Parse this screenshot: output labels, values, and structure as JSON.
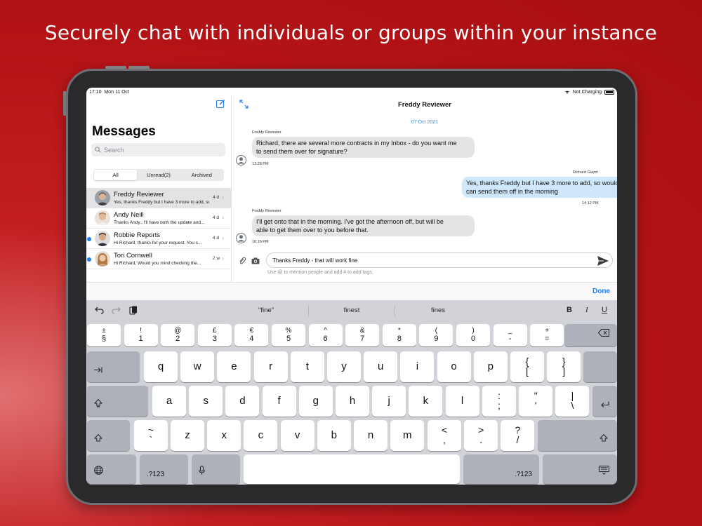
{
  "headline": "Securely chat with individuals or groups within your instance",
  "status": {
    "time": "17:10",
    "date": "Mon 11 Oct",
    "charging": "Not Charging"
  },
  "sidebar": {
    "title": "Messages",
    "search_placeholder": "Search",
    "filters": [
      {
        "label": "All"
      },
      {
        "label": "Unread(2)"
      },
      {
        "label": "Archived"
      }
    ],
    "conversations": [
      {
        "name": "Freddy Reviewer",
        "preview": "Yes, thanks Freddy but I have 3 more to add, so...",
        "time": "4 d",
        "unread": false,
        "selected": true
      },
      {
        "name": "Andy Neill",
        "preview": "Thanks Andy...I'll have both the update and...",
        "time": "4 d",
        "unread": false,
        "selected": false
      },
      {
        "name": "Robbie Reports",
        "preview": "Hi Richard, thanks for your request. You s...",
        "time": "4 d",
        "unread": true,
        "selected": false
      },
      {
        "name": "Tori Cornwell",
        "preview": "Hi Richard, Would you mind checking the...",
        "time": "2 w",
        "unread": true,
        "selected": false
      }
    ]
  },
  "chat": {
    "title": "Freddy Reviewer",
    "date": "07 Oct 2021",
    "messages": [
      {
        "sender": "Freddy Reviewer",
        "line1": "Richard, there are several more contracts in my Inbox - do you want me",
        "line2": "to send them over for signature?",
        "time": "13:28 PM",
        "direction": "in"
      },
      {
        "sender": "Richard Giazzi",
        "line1": "Yes, thanks Freddy but I have 3 more to add, so would be good if you",
        "line2": "can send them off in the morning",
        "time": "14:12 PM",
        "direction": "out"
      },
      {
        "sender": "Freddy Reviewer",
        "line1": "I'll get onto that in the morning. I've got the afternoon off, but will be",
        "line2": "able to get them over to you before that.",
        "time": "16:16 PM",
        "direction": "in"
      }
    ],
    "input_value": "Thanks Freddy - that will work fine",
    "hint": "Use @ to mention people and add # to add tags."
  },
  "done_label": "Done",
  "keyboard": {
    "suggestions": [
      "\"fine\"",
      "finest",
      "fines"
    ],
    "format": {
      "bold": "B",
      "italic": "I",
      "underline": "U"
    },
    "row1": [
      {
        "t": "±",
        "b": "§"
      },
      {
        "t": "!",
        "b": "1"
      },
      {
        "t": "@",
        "b": "2"
      },
      {
        "t": "£",
        "b": "3"
      },
      {
        "t": "€",
        "b": "4"
      },
      {
        "t": "%",
        "b": "5"
      },
      {
        "t": "^",
        "b": "6"
      },
      {
        "t": "&",
        "b": "7"
      },
      {
        "t": "*",
        "b": "8"
      },
      {
        "t": "(",
        "b": "9"
      },
      {
        "t": ")",
        "b": "0"
      },
      {
        "t": "_",
        "b": "-"
      },
      {
        "t": "+",
        "b": "="
      }
    ],
    "row2": [
      "q",
      "w",
      "e",
      "r",
      "t",
      "y",
      "u",
      "i",
      "o",
      "p"
    ],
    "row2_extra": [
      {
        "t": "{",
        "b": "["
      },
      {
        "t": "}",
        "b": "]"
      }
    ],
    "row3": [
      "a",
      "s",
      "d",
      "f",
      "g",
      "h",
      "j",
      "k",
      "l"
    ],
    "row3_extra": [
      {
        "t": ":",
        "b": ";"
      },
      {
        "t": "\"",
        "b": "'"
      },
      {
        "t": "|",
        "b": "\\"
      }
    ],
    "row4_left": {
      "t": "~",
      "b": "`"
    },
    "row4": [
      "z",
      "x",
      "c",
      "v",
      "b",
      "n",
      "m"
    ],
    "row4_extra": [
      {
        "t": "<",
        "b": ","
      },
      {
        "t": ">",
        "b": "."
      },
      {
        "t": "?",
        "b": "/"
      }
    ],
    "num_label": ".?123"
  }
}
